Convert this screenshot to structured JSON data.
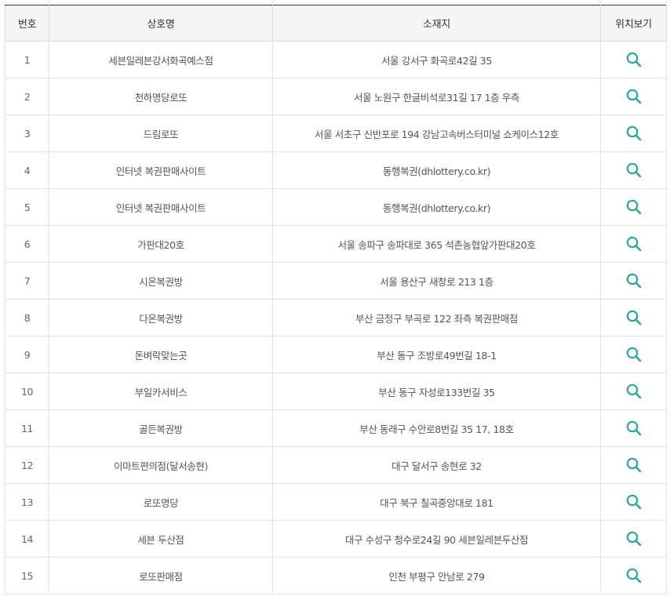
{
  "table": {
    "headers": {
      "number": "번호",
      "name": "상호명",
      "address": "소재지",
      "location": "위치보기"
    },
    "rows": [
      {
        "number": "1",
        "name": "세븐일레븐강서화곡예스점",
        "address": "서울 강서구 화곡로42길 35"
      },
      {
        "number": "2",
        "name": "천하명당로또",
        "address": "서울 노원구 한글비석로31길 17 1층 우측"
      },
      {
        "number": "3",
        "name": "드림로또",
        "address": "서울 서초구 신반포로 194 강남고속버스터미널 쇼케이스12호"
      },
      {
        "number": "4",
        "name": "인터넷 복권판매사이트",
        "address": "동행복권(dhlottery.co.kr)"
      },
      {
        "number": "5",
        "name": "인터넷 복권판매사이트",
        "address": "동행복권(dhlottery.co.kr)"
      },
      {
        "number": "6",
        "name": "가판대20호",
        "address": "서울 송파구 송파대로 365 석촌농협앞가판대20호"
      },
      {
        "number": "7",
        "name": "시온복권방",
        "address": "서울 용산구 새창로 213 1층"
      },
      {
        "number": "8",
        "name": "다온복권방",
        "address": "부산 금정구 부곡로 122 좌측 복권판매점"
      },
      {
        "number": "9",
        "name": "돈벼락맞는곳",
        "address": "부산 동구 조방로49번길 18-1"
      },
      {
        "number": "10",
        "name": "부일카서비스",
        "address": "부산 동구 자성로133번길 35"
      },
      {
        "number": "11",
        "name": "골든복권방",
        "address": "부산 동래구 수안로8번길 35 17, 18호"
      },
      {
        "number": "12",
        "name": "이마트편의점(달서송현)",
        "address": "대구 달서구 송현로 32"
      },
      {
        "number": "13",
        "name": "로또명당",
        "address": "대구 북구 칠곡중앙대로 181"
      },
      {
        "number": "14",
        "name": "세븐 두산점",
        "address": "대구 수성구 청수로24길 90 세븐일레븐두산점"
      },
      {
        "number": "15",
        "name": "로또판매점",
        "address": "인천 부평구 안남로 279"
      }
    ]
  },
  "icons": {
    "location": "search-icon"
  },
  "colors": {
    "accent": "#2aa79b",
    "header_bg": "#f5f5f5",
    "header_top_border": "#333333"
  }
}
